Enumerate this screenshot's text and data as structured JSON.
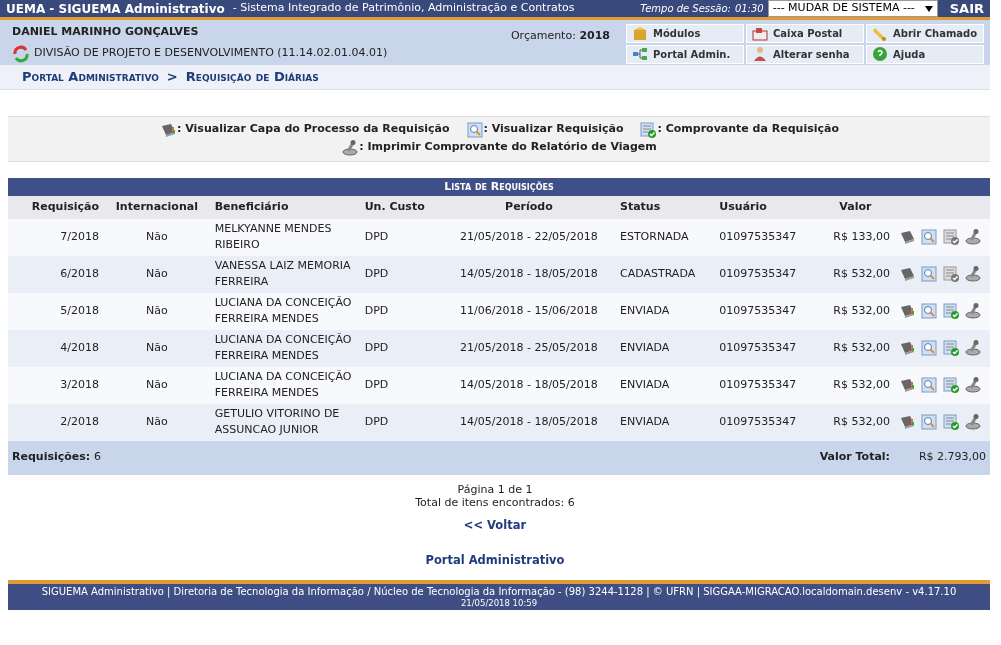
{
  "top_bar": {
    "title": "UEMA - SIGUEMA Administrativo",
    "subtitle": "- Sistema Integrado de Patrimônio, Administração e Contratos",
    "session_label": "Tempo de Sessão:",
    "session_time": "01:30",
    "system_select": "--- MUDAR DE SISTEMA ---",
    "logout": "SAIR"
  },
  "user": {
    "name": "DANIEL MARINHO GONÇALVES",
    "unit": "DIVISÃO DE PROJETO E DESENVOLVIMENTO (11.14.02.01.04.01)",
    "budget_label": "Orçamento:",
    "budget_year": "2018"
  },
  "shortcuts": [
    {
      "kind": "modules",
      "label": "Módulos"
    },
    {
      "kind": "mail",
      "label": "Caixa Postal"
    },
    {
      "kind": "ticket",
      "label": "Abrir Chamado"
    },
    {
      "kind": "portal",
      "label": "Portal Admin."
    },
    {
      "kind": "password",
      "label": "Alterar senha"
    },
    {
      "kind": "help",
      "label": "Ajuda"
    }
  ],
  "breadcrumb": [
    {
      "label": "Portal Administrativo"
    },
    {
      "label": "Requisição de Diárias"
    }
  ],
  "breadcrumb_separator": ">",
  "legend": [
    {
      "kind": "cover",
      "label": ": Visualizar Capa do Processo da Requisição"
    },
    {
      "kind": "view",
      "label": ": Visualizar Requisição"
    },
    {
      "kind": "receipt",
      "label": ": Comprovante da Requisição"
    },
    {
      "kind": "print",
      "label": ": Imprimir Comprovante do Relatório de Viagem"
    }
  ],
  "table": {
    "caption": "Lista de Requisições",
    "columns": [
      "Requisição",
      "Internacional",
      "Beneficiário",
      "Un. Custo",
      "Período",
      "Status",
      "Usuário",
      "Valor"
    ],
    "rows": [
      {
        "cells": [
          "7/2018",
          "Não",
          "MELKYANNE MENDES RIBEIRO",
          "DPD",
          "21/05/2018 - 22/05/2018",
          "ESTORNADA",
          "01097535347",
          "R$ 133,00"
        ],
        "receipt_enabled": false
      },
      {
        "cells": [
          "6/2018",
          "Não",
          "VANESSA LAIZ MEMORIA FERREIRA",
          "DPD",
          "14/05/2018 - 18/05/2018",
          "CADASTRADA",
          "01097535347",
          "R$ 532,00"
        ],
        "receipt_enabled": false
      },
      {
        "cells": [
          "5/2018",
          "Não",
          "LUCIANA DA CONCEIÇÃO FERREIRA MENDES",
          "DPD",
          "11/06/2018 - 15/06/2018",
          "ENVIADA",
          "01097535347",
          "R$ 532,00"
        ],
        "receipt_enabled": true
      },
      {
        "cells": [
          "4/2018",
          "Não",
          "LUCIANA DA CONCEIÇÃO FERREIRA MENDES",
          "DPD",
          "21/05/2018 - 25/05/2018",
          "ENVIADA",
          "01097535347",
          "R$ 532,00"
        ],
        "receipt_enabled": true
      },
      {
        "cells": [
          "3/2018",
          "Não",
          "LUCIANA DA CONCEIÇÃO FERREIRA MENDES",
          "DPD",
          "14/05/2018 - 18/05/2018",
          "ENVIADA",
          "01097535347",
          "R$ 532,00"
        ],
        "receipt_enabled": true
      },
      {
        "cells": [
          "2/2018",
          "Não",
          "GETULIO VITORINO DE ASSUNCAO JUNIOR",
          "DPD",
          "14/05/2018 - 18/05/2018",
          "ENVIADA",
          "01097535347",
          "R$ 532,00"
        ],
        "receipt_enabled": true
      }
    ],
    "count_label": "Requisições:",
    "count": "6",
    "total_label": "Valor Total:",
    "total": "R$ 2.793,00"
  },
  "pagination": {
    "page": "Página 1 de 1",
    "total": "Total de itens encontrados: 6"
  },
  "back_link": "<< Voltar",
  "portal_link": "Portal Administrativo",
  "footer": {
    "text": "SIGUEMA Administrativo | Diretoria de Tecnologia da Informação / Núcleo de Tecnologia da Informação - (98) 3244-1128 | © UFRN | SIGGAA-MIGRACAO.localdomain.desenv - v4.17.10",
    "date": "21/05/2018 10:59"
  }
}
